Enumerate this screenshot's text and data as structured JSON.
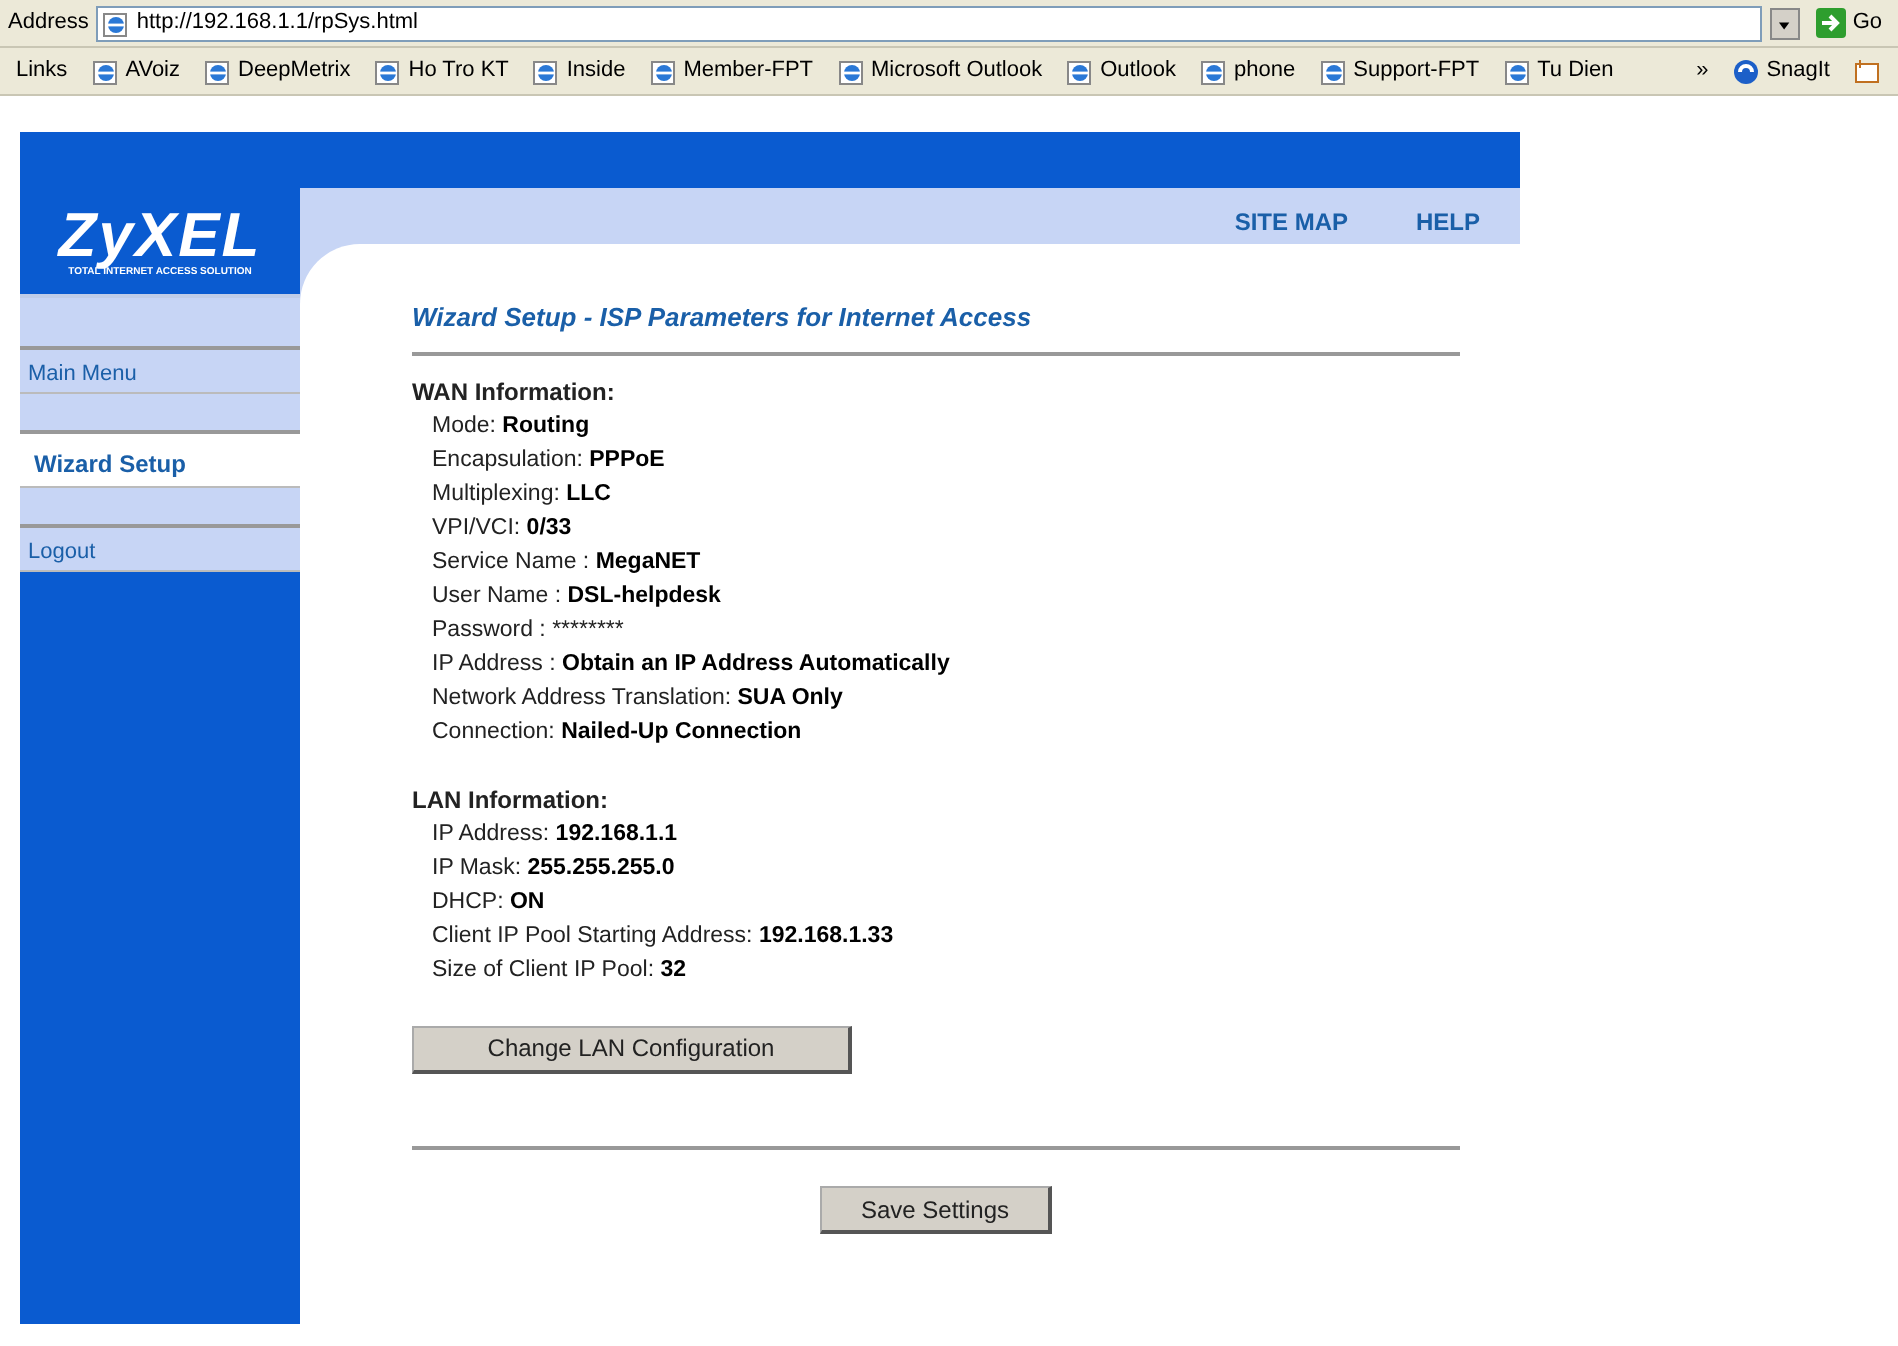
{
  "browser": {
    "address_label": "Address",
    "url": "http://192.168.1.1/rpSys.html",
    "go_label": "Go",
    "links_label": "Links",
    "links": [
      "AVoiz",
      "DeepMetrix",
      "Ho Tro KT",
      "Inside",
      "Member-FPT",
      "Microsoft Outlook",
      "Outlook",
      "phone",
      "Support-FPT",
      "Tu Dien"
    ],
    "overflow": "»",
    "snagit": "SnagIt"
  },
  "logo": {
    "name": "ZyXEL",
    "tagline": "TOTAL INTERNET ACCESS SOLUTION"
  },
  "top_links": [
    "SITE MAP",
    "HELP"
  ],
  "sidebar": {
    "items": [
      {
        "label": "Main Menu",
        "selected": false
      },
      {
        "label": "Wizard Setup",
        "selected": true
      },
      {
        "label": "Logout",
        "selected": false
      }
    ]
  },
  "title": "Wizard Setup - ISP Parameters for Internet Access",
  "sections": [
    {
      "heading": "WAN Information:",
      "lines": [
        {
          "label": "Mode:",
          "value": "Routing",
          "bold": true
        },
        {
          "label": "Encapsulation:",
          "value": "PPPoE",
          "bold": true
        },
        {
          "label": "Multiplexing:",
          "value": "LLC",
          "bold": true
        },
        {
          "label": "VPI/VCI:",
          "value": "0/33",
          "bold": true
        },
        {
          "label": "Service Name :",
          "value": "MegaNET",
          "bold": true
        },
        {
          "label": "User Name :",
          "value": "DSL-helpdesk",
          "bold": true
        },
        {
          "label": "Password :",
          "value": "********",
          "bold": false
        },
        {
          "label": "IP Address :",
          "value": "Obtain an IP Address Automatically",
          "bold": true
        },
        {
          "label": "Network Address Translation:",
          "value": "SUA Only",
          "bold": true
        },
        {
          "label": "Connection:",
          "value": "Nailed-Up Connection",
          "bold": true
        }
      ]
    },
    {
      "heading": "LAN Information:",
      "lines": [
        {
          "label": "IP Address:",
          "value": "192.168.1.1",
          "bold": true
        },
        {
          "label": "IP Mask:",
          "value": "255.255.255.0",
          "bold": true
        },
        {
          "label": "DHCP:",
          "value": "ON",
          "bold": true
        },
        {
          "label": "Client IP Pool Starting Address:",
          "value": "192.168.1.33",
          "bold": true
        },
        {
          "label": "Size of Client IP Pool:",
          "value": "32",
          "bold": true
        }
      ]
    }
  ],
  "change_button": "Change LAN Configuration",
  "save_button": "Save Settings"
}
